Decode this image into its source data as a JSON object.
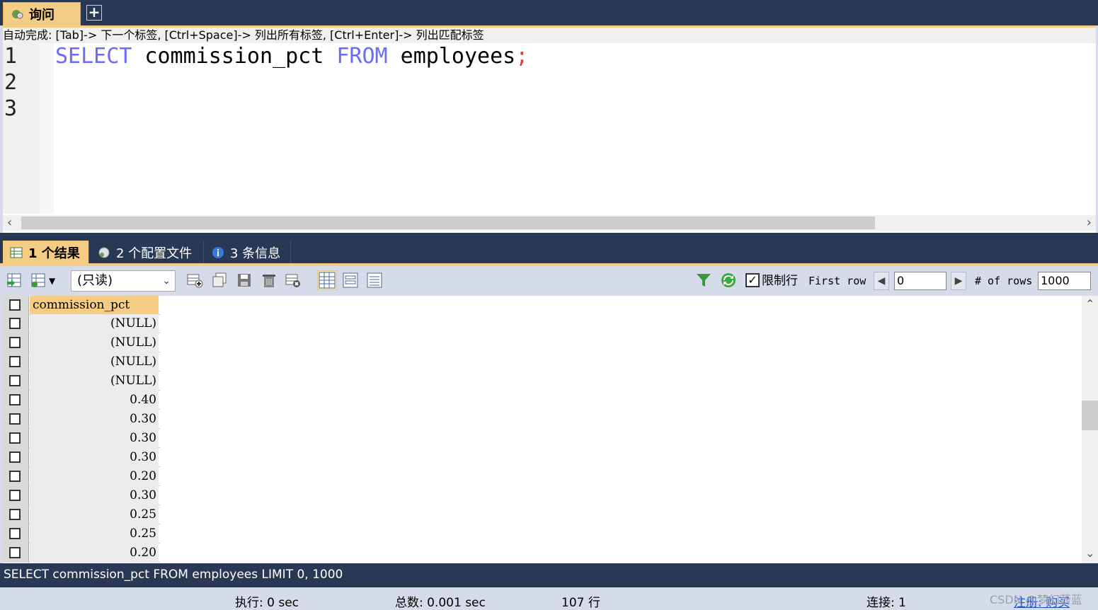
{
  "tabs": {
    "query_label": "询问",
    "add_label": "+"
  },
  "editor": {
    "hint": "自动完成: [Tab]-> 下一个标签, [Ctrl+Space]-> 列出所有标签, [Ctrl+Enter]-> 列出匹配标签",
    "line_numbers": [
      "1",
      "2",
      "3"
    ],
    "code": {
      "kw1": "SELECT",
      "ident1": " commission_pct ",
      "kw2": "FROM",
      "ident2": " employees",
      "semi": ";"
    }
  },
  "result_tabs": [
    {
      "label": "1 个结果"
    },
    {
      "label": "2 个配置文件"
    },
    {
      "label": "3 条信息"
    }
  ],
  "toolbar": {
    "mode_value": "(只读)",
    "limit_label": "限制行",
    "first_row_label": "First row",
    "first_row_value": "0",
    "rows_label": "# of rows",
    "rows_value": "1000"
  },
  "grid": {
    "column": "commission_pct",
    "rows": [
      "(NULL)",
      "(NULL)",
      "(NULL)",
      "(NULL)",
      "0.40",
      "0.30",
      "0.30",
      "0.30",
      "0.20",
      "0.30",
      "0.25",
      "0.25",
      "0.20"
    ]
  },
  "sqlbar": {
    "text": "SELECT commission_pct FROM employees LIMIT 0, 1000"
  },
  "status": {
    "exec": "执行: 0 sec",
    "total": "总数: 0.001 sec",
    "rows": "107 行",
    "conn": "连接: 1",
    "register": "注册: 购买",
    "watermark": "CSDN @梦幻蔚蓝"
  },
  "colors": {
    "accent": "#f5cc84",
    "frame": "#293955",
    "toolbar": "#d6dbe9",
    "keyword": "#6a6aff"
  }
}
